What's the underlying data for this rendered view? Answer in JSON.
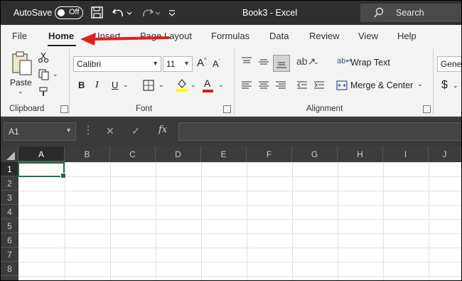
{
  "titlebar": {
    "autosave_label": "AutoSave",
    "autosave_state": "Off",
    "doc_title": "Book3  -  Excel",
    "search_placeholder": "Search"
  },
  "tabs": [
    "File",
    "Home",
    "Insert",
    "Page Layout",
    "Formulas",
    "Data",
    "Review",
    "View",
    "Help"
  ],
  "active_tab": "Home",
  "ribbon": {
    "clipboard": {
      "paste_label": "Paste",
      "group_label": "Clipboard"
    },
    "font": {
      "font_name": "Calibri",
      "font_size": "11",
      "bold": "B",
      "italic": "I",
      "underline": "U",
      "group_label": "Font",
      "highlight_color": "#ffff00",
      "font_color": "#e81123"
    },
    "alignment": {
      "wrap_text": "Wrap Text",
      "merge_center": "Merge & Center",
      "group_label": "Alignment"
    },
    "number": {
      "format": "Gener",
      "currency": "$"
    }
  },
  "formula_bar": {
    "name_box": "A1",
    "fx_label": "fx",
    "cancel": "✕",
    "enter": "✓"
  },
  "grid": {
    "columns": [
      "A",
      "B",
      "C",
      "D",
      "E",
      "F",
      "G",
      "H",
      "I",
      "J"
    ],
    "rows": [
      "1",
      "2",
      "3",
      "4",
      "5",
      "6",
      "7",
      "8"
    ],
    "selected_cell": "A1"
  },
  "annotation": {
    "color": "#e0201b",
    "points_to": "Home"
  }
}
